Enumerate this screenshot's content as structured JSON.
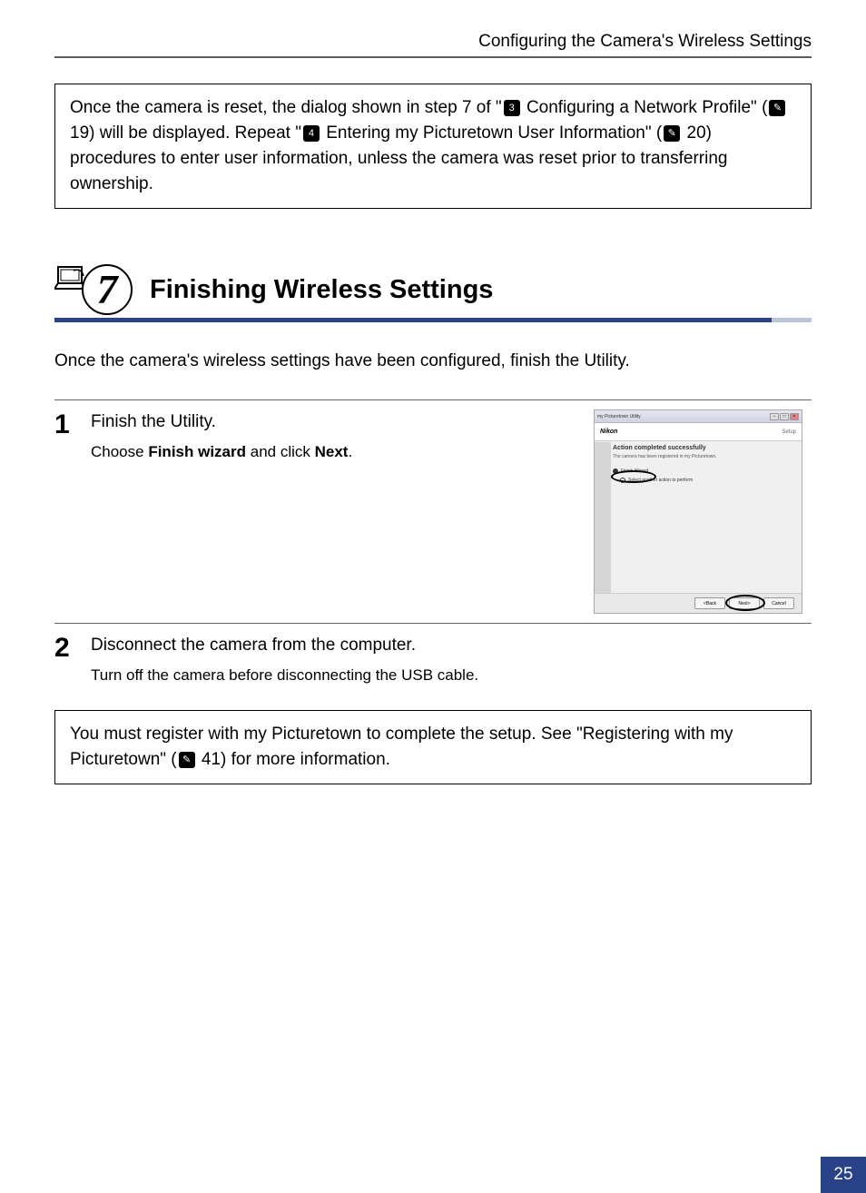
{
  "header": {
    "title": "Configuring the Camera's Wireless Settings"
  },
  "note1": {
    "p1a": "Once the camera is reset, the dialog shown in step 7 of \"",
    "p1b": " Configuring a Network Profile\" (",
    "p1c": " 19) will be displayed. Repeat \"",
    "p1d": " Entering my Picturetown User Information\" (",
    "p1e": " 20) procedures to enter user information, unless the camera was reset prior to transferring ownership.",
    "icon3": "3",
    "icon4": "4"
  },
  "section": {
    "step_number": "7",
    "title": "Finishing Wireless Settings",
    "intro": "Once the camera's wireless settings have been configured, finish the Utility."
  },
  "step1": {
    "num": "1",
    "title": "Finish the Utility.",
    "desc1": "Choose ",
    "desc_bold1": "Finish wizard",
    "desc2": " and click ",
    "desc_bold2": "Next",
    "desc3": "."
  },
  "dialog": {
    "titlebar": "my Picturetown Utility",
    "brand": "Nikon",
    "setup_label": "Setup",
    "action_title": "Action completed successfully",
    "action_sub": "The camera has been registered in my Picturetown.",
    "radio1": "Finish Wizard",
    "radio2": "Select another action to perform",
    "btn_back": "<Back",
    "btn_next": "Next>",
    "btn_cancel": "Cancel"
  },
  "step2": {
    "num": "2",
    "title": "Disconnect the camera from the computer.",
    "desc": "Turn off the camera before disconnecting the USB cable."
  },
  "note2": {
    "p1": "You must register with my Picturetown to complete the setup. See \"Registering with my Picturetown\" (",
    "p2": " 41) for more information."
  },
  "page_number": "25"
}
